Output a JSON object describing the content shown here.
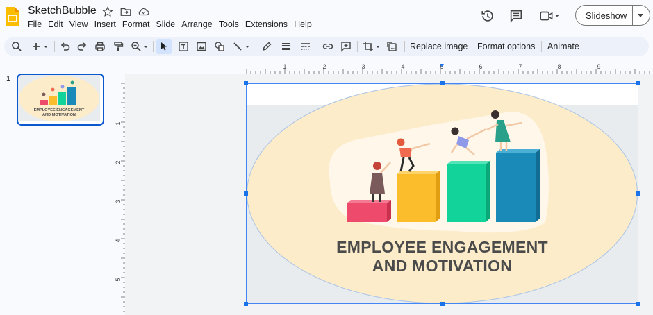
{
  "app": {
    "title": "SketchBubble",
    "menu": [
      "File",
      "Edit",
      "View",
      "Insert",
      "Format",
      "Slide",
      "Arrange",
      "Tools",
      "Extensions",
      "Help"
    ],
    "slideshow_label": "Slideshow"
  },
  "toolbar": {
    "replace_image": "Replace image",
    "format_options": "Format options",
    "animate": "Animate"
  },
  "ruler": {
    "horizontal": [
      "1",
      "2",
      "3",
      "4",
      "5",
      "6",
      "7",
      "8",
      "9"
    ],
    "vertical": [
      "1",
      "2",
      "3",
      "4",
      "5"
    ]
  },
  "filmstrip": {
    "slide_number": "1",
    "thumb_title_line1": "EMPLOYEE ENGAGEMENT",
    "thumb_title_line2": "AND MOTIVATION"
  },
  "slide": {
    "title_line1": "EMPLOYEE ENGAGEMENT",
    "title_line2": "AND MOTIVATION"
  },
  "colors": {
    "accent": "#0b57d0",
    "oval": "#fcecc9",
    "bar1": "#ee4a6b",
    "bar2": "#fbbd2c",
    "bar3": "#12d39a",
    "bar4": "#1a8ab8"
  }
}
